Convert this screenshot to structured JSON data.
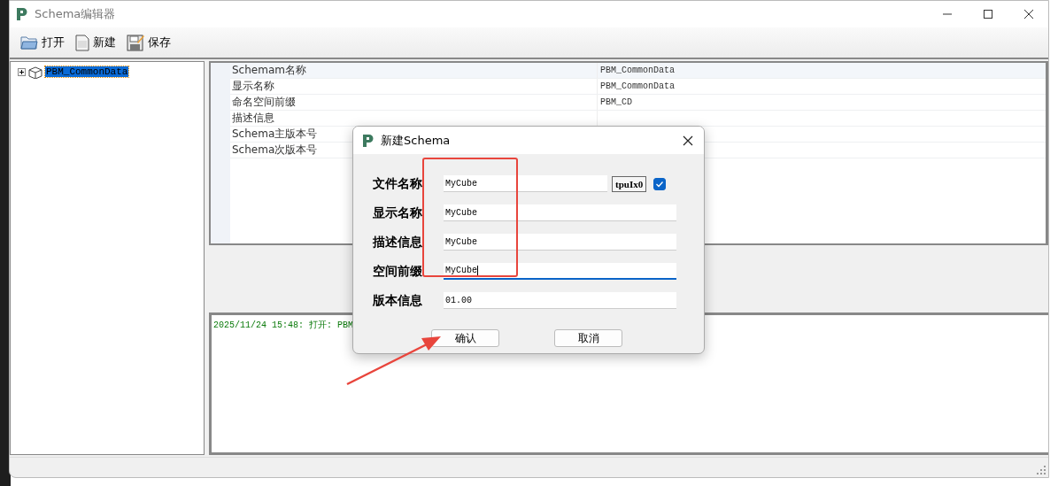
{
  "window": {
    "title": "Schema编辑器"
  },
  "toolbar": [
    {
      "label": "打开",
      "kind": "open"
    },
    {
      "label": "新建",
      "kind": "new"
    },
    {
      "label": "保存",
      "kind": "save"
    }
  ],
  "tree": [
    {
      "label": "PBM_CommonData",
      "selected": true,
      "expanded": false
    }
  ],
  "properties": [
    {
      "name": "Schemam名称",
      "value": "PBM_CommonData",
      "selected": true
    },
    {
      "name": "显示名称",
      "value": "PBM_CommonData",
      "selected": false
    },
    {
      "name": "命名空间前缀",
      "value": "PBM_CD",
      "selected": false
    },
    {
      "name": "描述信息",
      "selected": false
    },
    {
      "name": "Schema主版本号",
      "selected": false
    },
    {
      "name": "Schema次版本号",
      "selected": false
    }
  ],
  "log": [
    "2025/11/24 15:48: 打开: PBM"
  ],
  "dialog": {
    "title": "新建Schema",
    "fields": [
      {
        "label": "文件名称",
        "value": "MyCube",
        "focused": false,
        "code": "tpuIx0",
        "checked": true
      },
      {
        "label": "显示名称",
        "value": "MyCube",
        "focused": false
      },
      {
        "label": "描述信息",
        "value": "MyCube",
        "focused": false
      },
      {
        "label": "空间前缀",
        "value": "MyCube",
        "focused": true
      },
      {
        "label": "版本信息",
        "value": "01.00",
        "focused": false
      }
    ],
    "buttons": [
      "确认",
      "取消"
    ]
  }
}
